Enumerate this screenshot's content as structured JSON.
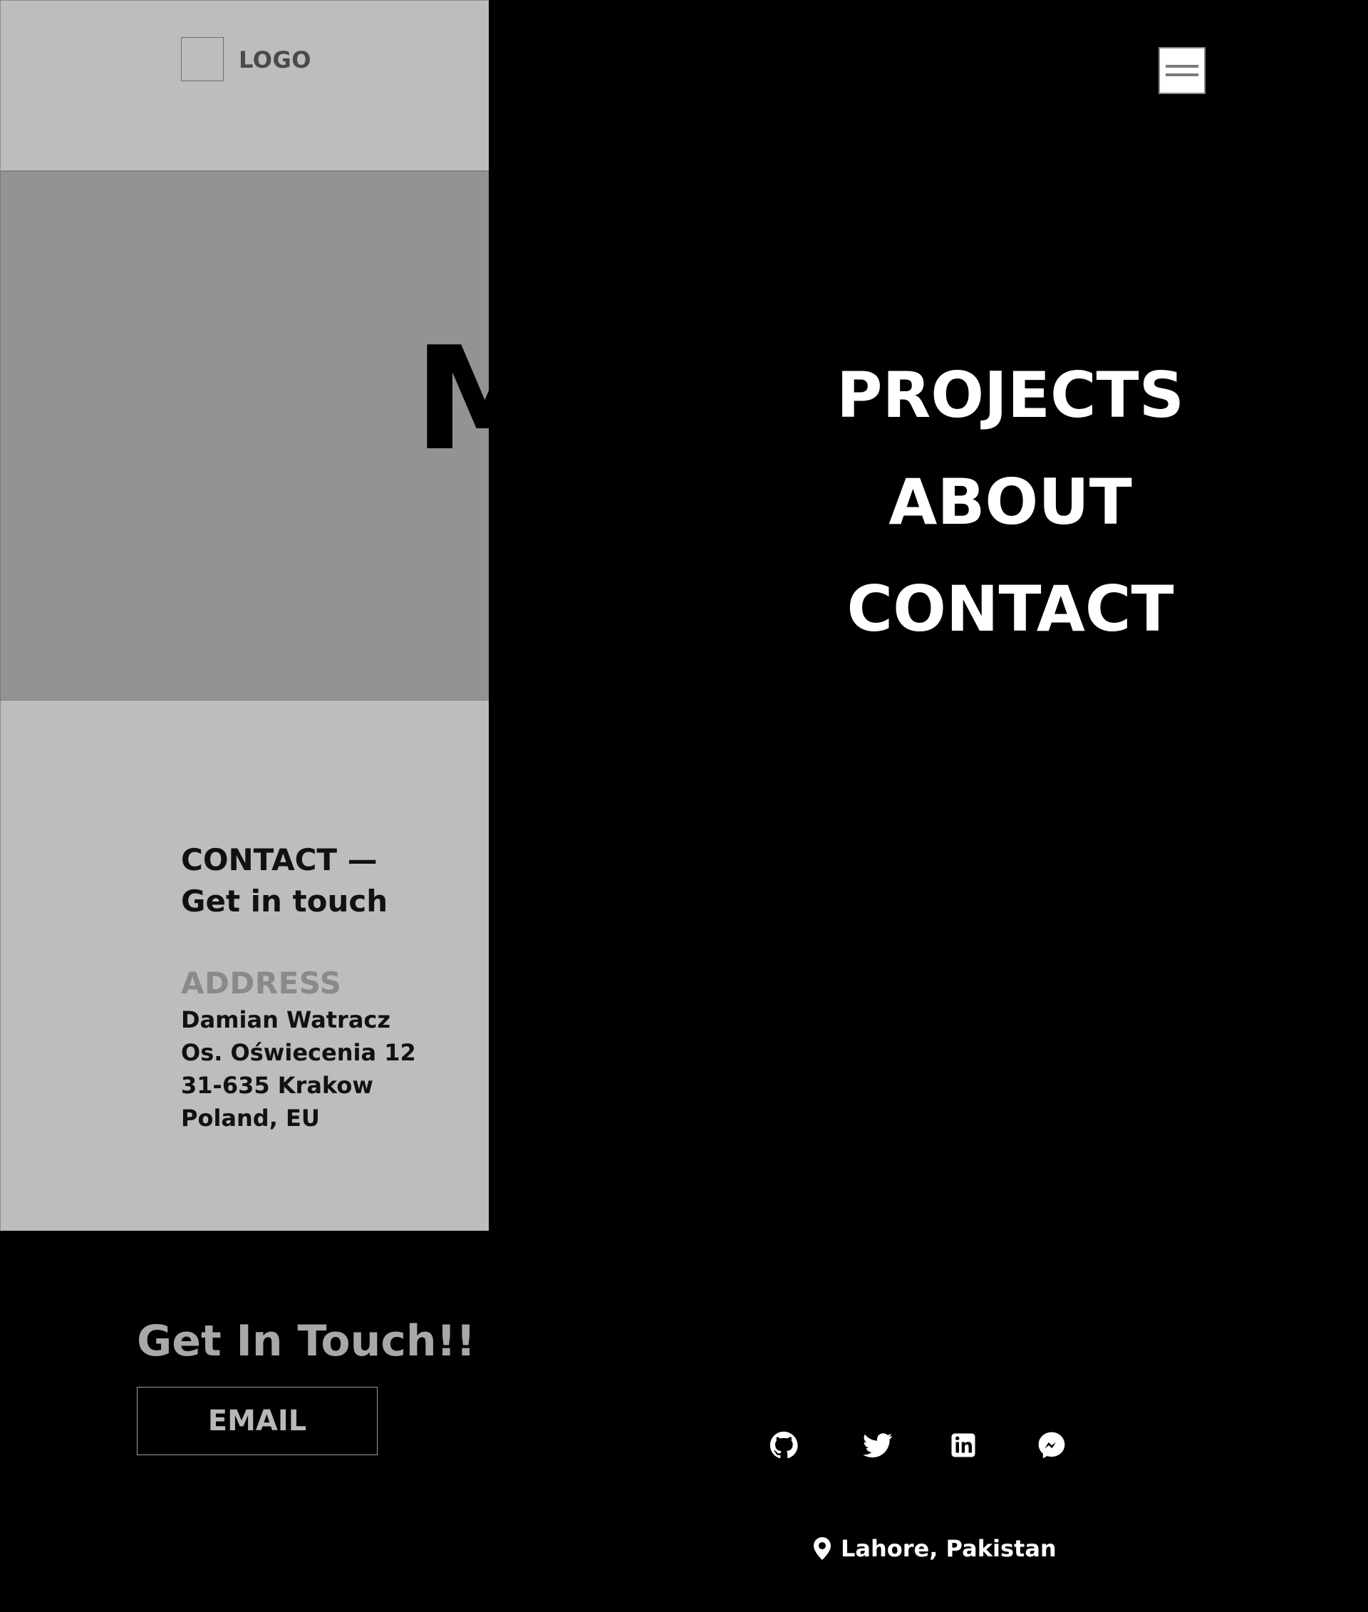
{
  "header": {
    "logo_text": "LOGO"
  },
  "hero": {
    "partial_heading": "M"
  },
  "contact_section": {
    "title": "CONTACT —\nGet in touch",
    "address_heading": "ADDRESS",
    "address_lines": [
      "Damian Watracz",
      "Os. Oświecenia 12",
      "31-635 Krakow",
      "Poland, EU"
    ]
  },
  "footer": {
    "heading": "Get In Touch!!",
    "email_button": "EMAIL"
  },
  "menu": {
    "items": [
      {
        "label": "PROJECTS"
      },
      {
        "label": "ABOUT"
      },
      {
        "label": "CONTACT"
      }
    ],
    "social": [
      {
        "icon": "github-icon"
      },
      {
        "icon": "twitter-icon"
      },
      {
        "icon": "linkedin-icon"
      },
      {
        "icon": "messenger-icon"
      }
    ],
    "location": "Lahore, Pakistan"
  },
  "colors": {
    "header_bg": "#bdbdbd",
    "hero_bg": "#939393",
    "overlay_bg": "#000000",
    "menu_text": "#ffffff",
    "muted_heading": "#8a8a8a"
  }
}
